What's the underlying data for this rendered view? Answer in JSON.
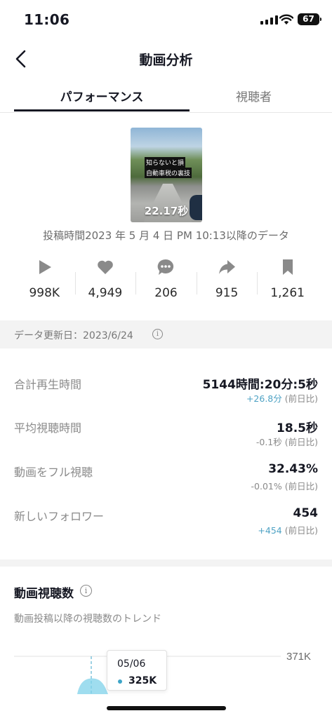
{
  "status_bar": {
    "time": "11:06",
    "battery": "67"
  },
  "nav": {
    "title": "動画分析",
    "back_icon": "chevron-left-icon"
  },
  "tabs": [
    {
      "label": "パフォーマンス",
      "active": true
    },
    {
      "label": "視聴者",
      "active": false
    }
  ],
  "video": {
    "caption_line1": "知らないと損",
    "caption_line2": "自動車税の裏技",
    "duration": "22.17秒"
  },
  "post_time": "投稿時間2023 年 5 月 4 日 PM 10:13以降のデータ",
  "stats": [
    {
      "icon": "play-icon",
      "value": "998K"
    },
    {
      "icon": "heart-icon",
      "value": "4,949"
    },
    {
      "icon": "comment-icon",
      "value": "206"
    },
    {
      "icon": "share-icon",
      "value": "915"
    },
    {
      "icon": "bookmark-icon",
      "value": "1,261"
    }
  ],
  "update_bar": {
    "text": "データ更新日：2023/6/24",
    "info_icon": "info-icon"
  },
  "metrics": [
    {
      "label": "合計再生時間",
      "value": "5144時間:20分:5秒",
      "change": "+26.8分",
      "change_suffix": " (前日比)",
      "change_color": "#4ea2c4"
    },
    {
      "label": "平均視聴時間",
      "value": "18.5秒",
      "change": "-0.1秒",
      "change_suffix": " (前日比)",
      "change_color": "#8a8a8a"
    },
    {
      "label": "動画をフル視聴",
      "value": "32.43%",
      "change": "-0.01%",
      "change_suffix": " (前日比)",
      "change_color": "#8a8a8a"
    },
    {
      "label": "新しいフォロワー",
      "value": "454",
      "change": "+454",
      "change_suffix": " (前日比)",
      "change_color": "#4ea2c4"
    }
  ],
  "views_section": {
    "title": "動画視聴数",
    "subtitle": "動画投稿以降の視聴数のトレンド",
    "y_max_label": "371K",
    "tooltip_date": "05/06",
    "tooltip_value": "325K"
  },
  "colors": {
    "accent": "#3ea5c8",
    "positive": "#4ea2c4",
    "text": "#161823",
    "muted": "#8a8a8a"
  }
}
